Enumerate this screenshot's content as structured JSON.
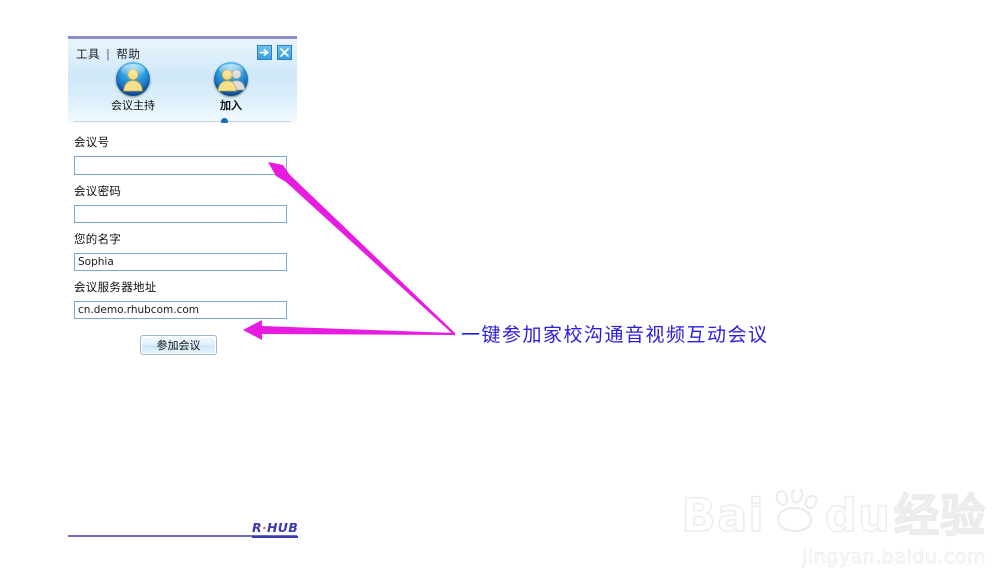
{
  "window": {
    "menu": {
      "tools_label": "工具",
      "separator": "|",
      "help_label": "帮助"
    },
    "title_buttons": {
      "minimize_label": "→",
      "close_label": "✕"
    },
    "tabs": [
      {
        "id": "host",
        "label": "会议主持",
        "icon": "single-person-icon",
        "selected": false
      },
      {
        "id": "join",
        "label": "加入",
        "icon": "two-person-icon",
        "selected": true
      }
    ],
    "form": {
      "fields": [
        {
          "id": "meeting-id",
          "label": "会议号",
          "value": "",
          "type": "text"
        },
        {
          "id": "meeting-password",
          "label": "会议密码",
          "value": "",
          "type": "password"
        },
        {
          "id": "your-name",
          "label": "您的名字",
          "value": "Sophia",
          "type": "text"
        },
        {
          "id": "server-address",
          "label": "会议服务器地址",
          "value": "cn.demo.rhubcom.com",
          "type": "text"
        }
      ],
      "submit_label": "参加会议"
    }
  },
  "brand": {
    "logo_r": "R",
    "logo_dot": "·",
    "logo_hub": "HUB"
  },
  "annotation": {
    "text": "一键参加家校沟通音视频互动会议",
    "color": "#2a1ce0",
    "arrow_color": "#e81ce0"
  },
  "watermark": {
    "bai": "Bai",
    "du": "du",
    "jingyan": "经验",
    "url": "jingyan.baidu.com"
  }
}
